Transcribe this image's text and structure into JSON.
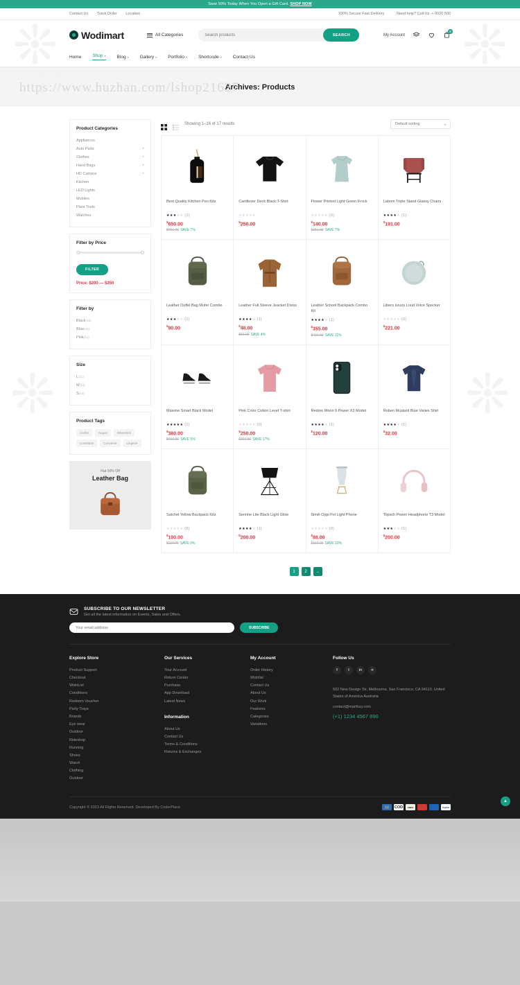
{
  "promo": {
    "text": "Save 50% Today When You Open a Gift Card.",
    "cta": "SHOP NOW"
  },
  "topbar": {
    "left": [
      "Contact Us",
      "Track Order",
      "Location"
    ],
    "right": [
      "100% Secure Fast Delivery",
      "Need help? Call Us: + 0020 500"
    ]
  },
  "header": {
    "brand": "Wodimart",
    "all_categories": "All Categories",
    "search_placeholder": "Search products",
    "search_value": "",
    "search_button": "SEARCH",
    "my_account": "My Account",
    "cart_count": "0"
  },
  "nav": [
    {
      "label": "Home",
      "caret": false,
      "active": false
    },
    {
      "label": "Shop",
      "caret": true,
      "active": true
    },
    {
      "label": "Blog",
      "caret": true,
      "active": false
    },
    {
      "label": "Gallery",
      "caret": true,
      "active": false
    },
    {
      "label": "Portfolio",
      "caret": true,
      "active": false
    },
    {
      "label": "Shortcode",
      "caret": true,
      "active": false
    },
    {
      "label": "Contact Us",
      "caret": false,
      "active": false
    }
  ],
  "hero": {
    "title": "Archives: Products",
    "watermark": "https://www.huzhan.com/lshop21627"
  },
  "sidebar": {
    "categories_title": "Product Categories",
    "categories": [
      {
        "label": "Appliances",
        "expandable": false
      },
      {
        "label": "Auto Parts",
        "expandable": true
      },
      {
        "label": "Clothes",
        "expandable": true
      },
      {
        "label": "Hand Bags",
        "expandable": true
      },
      {
        "label": "HD Camera",
        "expandable": true
      },
      {
        "label": "Kitchen",
        "expandable": false
      },
      {
        "label": "LED Lights",
        "expandable": false
      },
      {
        "label": "Mobiles",
        "expandable": false
      },
      {
        "label": "Plant Tools",
        "expandable": false
      },
      {
        "label": "Watches",
        "expandable": false
      }
    ],
    "price_title": "Filter by Price",
    "filter_button": "FILTER",
    "price_range": "Price: $200 — $250",
    "filterby_title": "Filter by",
    "colors": [
      {
        "label": "Black",
        "count": "(15)"
      },
      {
        "label": "Blue",
        "count": "(15)"
      },
      {
        "label": "Pink",
        "count": "(14)"
      }
    ],
    "size_title": "Size",
    "sizes": [
      {
        "label": "L",
        "count": "(11)"
      },
      {
        "label": "M",
        "count": "(12)"
      },
      {
        "label": "S",
        "count": "(12)"
      }
    ],
    "tags_title": "Product Tags",
    "tags": [
      "Audire",
      "Augue",
      "Bibendum",
      "Constituto",
      "Converse",
      "Lingerie"
    ],
    "banner": {
      "small": "Flat 50% Off",
      "big": "Leather Bag"
    }
  },
  "toolbar": {
    "result_count": "Showing 1–16 of 17 results",
    "sort_value": "Default sorting"
  },
  "products": [
    {
      "name": "Best Quality Kitchen Pen Kits",
      "rating": 3,
      "reviews": "(1)",
      "price": "650.00",
      "old": "$701.00",
      "save": "SAVE 7%",
      "img": "bottle"
    },
    {
      "name": "Cantilever Deck Black T-Shirt",
      "rating": 0,
      "reviews": "",
      "price": "250.00",
      "old": "",
      "save": "",
      "img": "sweater"
    },
    {
      "name": "Flower Printed Light Green Frock",
      "rating": 0,
      "reviews": "(0)",
      "price": "140.00",
      "old": "$151.00",
      "save": "SAVE 7%",
      "img": "frock"
    },
    {
      "name": "Labom Triple Stand Glassy Chairs",
      "rating": 4,
      "reviews": "(1)",
      "price": "191.00",
      "old": "",
      "save": "",
      "img": "chair"
    },
    {
      "name": "Leather Duffel Bag Mufer Combo",
      "rating": 3,
      "reviews": "(1)",
      "price": "90.00",
      "old": "",
      "save": "",
      "img": "greenbag"
    },
    {
      "name": "Leather Full Sleeve Jeacket Dress",
      "rating": 4,
      "reviews": "(1)",
      "price": "48.00",
      "old": "$50.00",
      "save": "SAVE 4%",
      "img": "jacket"
    },
    {
      "name": "Leather School Backpack Combo Kit",
      "rating": 4,
      "reviews": "(1)",
      "price": "355.00",
      "old": "$400.00",
      "save": "SAVE 11%",
      "img": "brownbag"
    },
    {
      "name": "Libero luxury Loud Voice Specker",
      "rating": 0,
      "reviews": "(0)",
      "price": "221.00",
      "old": "",
      "save": "",
      "img": "speaker"
    },
    {
      "name": "Maxime Smart Black Model",
      "rating": 5,
      "reviews": "(1)",
      "price": "380.00",
      "old": "$400.00",
      "save": "SAVE 5%",
      "img": "shoes"
    },
    {
      "name": "Pink Color Cotton Level T-shirt",
      "rating": 0,
      "reviews": "(0)",
      "price": "250.00",
      "old": "$301.00",
      "save": "SAVE 17%",
      "img": "pinktee"
    },
    {
      "name": "Redmo Morin 9 Power X3 Model",
      "rating": 4,
      "reviews": "(1)",
      "price": "120.00",
      "old": "",
      "save": "",
      "img": "phone"
    },
    {
      "name": "Roben Mustard Blue Varies Shirt",
      "rating": 4,
      "reviews": "(1)",
      "price": "32.00",
      "old": "",
      "save": "",
      "img": "blueshirt"
    },
    {
      "name": "Satchel Yellow Backpack Kits",
      "rating": 0,
      "reviews": "(0)",
      "price": "100.00",
      "old": "$110.00",
      "save": "SAVE 9%",
      "img": "greenbag2"
    },
    {
      "name": "Sennhe Lite Black Light Glow",
      "rating": 4,
      "reviews": "(1)",
      "price": "200.00",
      "old": "",
      "save": "",
      "img": "lamp"
    },
    {
      "name": "Simili Oppi Fol Light Phone",
      "rating": 0,
      "reviews": "(0)",
      "price": "88.00",
      "old": "$101.00",
      "save": "SAVE 13%",
      "img": "glasslamp"
    },
    {
      "name": "Tlipsch Power Headphone T3 Model",
      "rating": 3,
      "reviews": "(1)",
      "price": "200.00",
      "old": "",
      "save": "",
      "img": "headphone"
    }
  ],
  "pagination": [
    "1",
    "2",
    "→"
  ],
  "newsletter": {
    "title": "SUBSCRIBE TO OUR NEWSLETTER",
    "subtitle": "Get all the latest information on Events, Sales and Offers.",
    "placeholder": "Your email address",
    "value": "",
    "button": "SUBSCRIBE"
  },
  "footer": {
    "col1": {
      "title": "Explore Store",
      "items": [
        "Product Support",
        "Checkout",
        "WishList",
        "Conditions",
        "Redeem Voucher",
        "Party Trays",
        "Brands",
        "Eye wear",
        "Outdoor",
        "Rideshop",
        "Running",
        "Shoes",
        "Watch",
        "Clothing",
        "Outdoor"
      ]
    },
    "col2": {
      "title": "Our Services",
      "items": [
        "Your Account",
        "Return Center",
        "Purchase",
        "App Download",
        "Latest News"
      ],
      "title2": "Information",
      "items2": [
        "About Us",
        "Contact Us",
        "Terms & Conditions",
        "Returns & Exchanges"
      ]
    },
    "col3": {
      "title": "My Account",
      "items": [
        "Order History",
        "Wishlist",
        "Contact Us",
        "About Us",
        "Our Work",
        "Features",
        "Categories",
        "Variations"
      ]
    },
    "col4": {
      "title": "Follow Us",
      "socials": [
        "facebook-icon",
        "twitter-icon",
        "linkedin-icon",
        "rss-icon"
      ],
      "address": "502 New Design Str, Melbourne, San Francisco, CA 94110, United States of America Australia",
      "email": "contact@martfury.com",
      "phone": "(+1) 1234 4567 890"
    },
    "copyright": "Copyright © 2023 All Rights Reserved. Developed By CoderPlace",
    "payments": [
      "card",
      "COD",
      "AMEX",
      "mastercard",
      "maestro",
      "PayPal"
    ]
  },
  "colors": {
    "accent": "#14a085",
    "promo": "#2ba88b",
    "price": "#e8313b",
    "save": "#2ba88b",
    "footer_bg": "#1c1c1c"
  }
}
